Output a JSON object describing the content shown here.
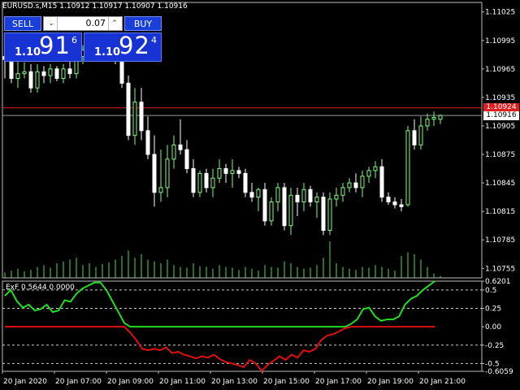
{
  "header": {
    "symbol_timeframe": "EURUSD.s,M15",
    "ohlc": "1.10912 1.10917 1.10907 1.10916"
  },
  "trade_panel": {
    "sell_label": "SELL",
    "buy_label": "BUY",
    "lot_value": "0.07",
    "bid": {
      "prefix": "1.10",
      "big": "91",
      "sup": "6"
    },
    "ask": {
      "prefix": "1.10",
      "big": "92",
      "sup": "4"
    }
  },
  "price_tags": {
    "ask": "1.10924",
    "bid": "1.10916"
  },
  "price_axis": [
    "1.11025",
    "1.10995",
    "1.10965",
    "1.10935",
    "1.10905",
    "1.10875",
    "1.10845",
    "1.10815",
    "1.10785",
    "1.10755"
  ],
  "indicator": {
    "title": "ExF 0.5644 0.0000",
    "axis": [
      "0.6201",
      "0.5",
      "0.25",
      "0.00",
      "-0.25",
      "-0.5",
      "-0.6059"
    ]
  },
  "time_axis": [
    "20 Jan 2020",
    "20 Jan 07:00",
    "20 Jan 09:00",
    "20 Jan 11:00",
    "20 Jan 13:00",
    "20 Jan 15:00",
    "20 Jan 17:00",
    "20 Jan 19:00",
    "20 Jan 21:00"
  ],
  "colors": {
    "bull": "#7cfc7c",
    "bear": "#ffffff",
    "grid": "#d9d9d9",
    "ask_line": "#e02020",
    "green_line": "#22dd22",
    "red_line": "#e01010"
  },
  "chart_data": [
    {
      "type": "candlestick",
      "title": "EURUSD.s,M15",
      "ylim": [
        1.10745,
        1.11035
      ],
      "candles": [
        {
          "o": 1.10978,
          "h": 1.10995,
          "l": 1.10955,
          "c": 1.10975
        },
        {
          "o": 1.10975,
          "h": 1.1099,
          "l": 1.1095,
          "c": 1.10955
        },
        {
          "o": 1.10955,
          "h": 1.10975,
          "l": 1.10945,
          "c": 1.1096
        },
        {
          "o": 1.1096,
          "h": 1.10972,
          "l": 1.10955,
          "c": 1.10962
        },
        {
          "o": 1.10962,
          "h": 1.1097,
          "l": 1.1094,
          "c": 1.10945
        },
        {
          "o": 1.10945,
          "h": 1.1097,
          "l": 1.1094,
          "c": 1.10962
        },
        {
          "o": 1.10962,
          "h": 1.10968,
          "l": 1.1095,
          "c": 1.10958
        },
        {
          "o": 1.10958,
          "h": 1.1097,
          "l": 1.1095,
          "c": 1.10965
        },
        {
          "o": 1.10965,
          "h": 1.10968,
          "l": 1.10952,
          "c": 1.10955
        },
        {
          "o": 1.10955,
          "h": 1.1097,
          "l": 1.1095,
          "c": 1.10965
        },
        {
          "o": 1.10965,
          "h": 1.1098,
          "l": 1.10955,
          "c": 1.1096
        },
        {
          "o": 1.1096,
          "h": 1.10985,
          "l": 1.10955,
          "c": 1.10978
        },
        {
          "o": 1.10978,
          "h": 1.1099,
          "l": 1.1097,
          "c": 1.10985
        },
        {
          "o": 1.10985,
          "h": 1.10995,
          "l": 1.10975,
          "c": 1.1099
        },
        {
          "o": 1.1099,
          "h": 1.11,
          "l": 1.10982,
          "c": 1.10988
        },
        {
          "o": 1.10988,
          "h": 1.10998,
          "l": 1.1098,
          "c": 1.10993
        },
        {
          "o": 1.10993,
          "h": 1.11002,
          "l": 1.10975,
          "c": 1.10985
        },
        {
          "o": 1.10985,
          "h": 1.10995,
          "l": 1.1097,
          "c": 1.1098
        },
        {
          "o": 1.1098,
          "h": 1.1099,
          "l": 1.10945,
          "c": 1.1095
        },
        {
          "o": 1.1095,
          "h": 1.10958,
          "l": 1.1089,
          "c": 1.10895
        },
        {
          "o": 1.10895,
          "h": 1.10945,
          "l": 1.10885,
          "c": 1.1093
        },
        {
          "o": 1.1093,
          "h": 1.10945,
          "l": 1.1089,
          "c": 1.109
        },
        {
          "o": 1.109,
          "h": 1.10915,
          "l": 1.1087,
          "c": 1.10875
        },
        {
          "o": 1.10875,
          "h": 1.10895,
          "l": 1.1082,
          "c": 1.10835
        },
        {
          "o": 1.10835,
          "h": 1.1088,
          "l": 1.10825,
          "c": 1.1084
        },
        {
          "o": 1.1084,
          "h": 1.10885,
          "l": 1.1083,
          "c": 1.1087
        },
        {
          "o": 1.1087,
          "h": 1.10895,
          "l": 1.1086,
          "c": 1.10885
        },
        {
          "o": 1.10885,
          "h": 1.10912,
          "l": 1.10875,
          "c": 1.1088
        },
        {
          "o": 1.1088,
          "h": 1.1089,
          "l": 1.10855,
          "c": 1.1086
        },
        {
          "o": 1.1086,
          "h": 1.1087,
          "l": 1.1083,
          "c": 1.10835
        },
        {
          "o": 1.10835,
          "h": 1.10858,
          "l": 1.1083,
          "c": 1.10855
        },
        {
          "o": 1.10855,
          "h": 1.1086,
          "l": 1.10835,
          "c": 1.1084
        },
        {
          "o": 1.1084,
          "h": 1.1086,
          "l": 1.1083,
          "c": 1.1085
        },
        {
          "o": 1.1085,
          "h": 1.1087,
          "l": 1.10845,
          "c": 1.1086
        },
        {
          "o": 1.1086,
          "h": 1.10865,
          "l": 1.10845,
          "c": 1.10855
        },
        {
          "o": 1.10855,
          "h": 1.1087,
          "l": 1.1084,
          "c": 1.10858
        },
        {
          "o": 1.10858,
          "h": 1.10862,
          "l": 1.1085,
          "c": 1.10855
        },
        {
          "o": 1.10855,
          "h": 1.1086,
          "l": 1.1083,
          "c": 1.10835
        },
        {
          "o": 1.10835,
          "h": 1.10845,
          "l": 1.10825,
          "c": 1.1083
        },
        {
          "o": 1.1083,
          "h": 1.1084,
          "l": 1.10815,
          "c": 1.10838
        },
        {
          "o": 1.10838,
          "h": 1.10845,
          "l": 1.108,
          "c": 1.10805
        },
        {
          "o": 1.10805,
          "h": 1.1083,
          "l": 1.108,
          "c": 1.10825
        },
        {
          "o": 1.10825,
          "h": 1.10845,
          "l": 1.10815,
          "c": 1.1084
        },
        {
          "o": 1.1084,
          "h": 1.10845,
          "l": 1.10795,
          "c": 1.108
        },
        {
          "o": 1.108,
          "h": 1.1084,
          "l": 1.1079,
          "c": 1.10832
        },
        {
          "o": 1.10832,
          "h": 1.1084,
          "l": 1.1081,
          "c": 1.10825
        },
        {
          "o": 1.10825,
          "h": 1.10845,
          "l": 1.10815,
          "c": 1.10838
        },
        {
          "o": 1.10838,
          "h": 1.10842,
          "l": 1.1082,
          "c": 1.10825
        },
        {
          "o": 1.10825,
          "h": 1.10835,
          "l": 1.10808,
          "c": 1.1083
        },
        {
          "o": 1.1083,
          "h": 1.10835,
          "l": 1.1079,
          "c": 1.10795
        },
        {
          "o": 1.10795,
          "h": 1.10835,
          "l": 1.1079,
          "c": 1.10828
        },
        {
          "o": 1.10828,
          "h": 1.1084,
          "l": 1.1082,
          "c": 1.10832
        },
        {
          "o": 1.10832,
          "h": 1.10845,
          "l": 1.10825,
          "c": 1.1084
        },
        {
          "o": 1.1084,
          "h": 1.1085,
          "l": 1.10835,
          "c": 1.10845
        },
        {
          "o": 1.10845,
          "h": 1.10855,
          "l": 1.10835,
          "c": 1.1084
        },
        {
          "o": 1.1084,
          "h": 1.10858,
          "l": 1.1083,
          "c": 1.10852
        },
        {
          "o": 1.10852,
          "h": 1.10862,
          "l": 1.10845,
          "c": 1.10858
        },
        {
          "o": 1.10858,
          "h": 1.10868,
          "l": 1.1085,
          "c": 1.10862
        },
        {
          "o": 1.10862,
          "h": 1.1087,
          "l": 1.10825,
          "c": 1.1083
        },
        {
          "o": 1.1083,
          "h": 1.10835,
          "l": 1.10822,
          "c": 1.10825
        },
        {
          "o": 1.10825,
          "h": 1.1083,
          "l": 1.10818,
          "c": 1.10822
        },
        {
          "o": 1.10822,
          "h": 1.10828,
          "l": 1.10815,
          "c": 1.1082
        },
        {
          "o": 1.10822,
          "h": 1.10905,
          "l": 1.1082,
          "c": 1.109
        },
        {
          "o": 1.109,
          "h": 1.10912,
          "l": 1.1088,
          "c": 1.10885
        },
        {
          "o": 1.10885,
          "h": 1.10915,
          "l": 1.1088,
          "c": 1.10905
        },
        {
          "o": 1.10905,
          "h": 1.10918,
          "l": 1.109,
          "c": 1.10912
        },
        {
          "o": 1.10912,
          "h": 1.1092,
          "l": 1.10905,
          "c": 1.10914
        },
        {
          "o": 1.10912,
          "h": 1.10917,
          "l": 1.10907,
          "c": 1.10916
        }
      ],
      "volumes": [
        0.15,
        0.2,
        0.25,
        0.18,
        0.22,
        0.3,
        0.35,
        0.28,
        0.4,
        0.45,
        0.5,
        0.55,
        0.35,
        0.4,
        0.3,
        0.38,
        0.42,
        0.5,
        0.6,
        0.75,
        0.55,
        0.65,
        0.5,
        0.45,
        0.4,
        0.5,
        0.35,
        0.3,
        0.28,
        0.4,
        0.32,
        0.3,
        0.25,
        0.35,
        0.3,
        0.28,
        0.22,
        0.3,
        0.25,
        0.2,
        0.35,
        0.3,
        0.28,
        0.45,
        0.4,
        0.3,
        0.25,
        0.28,
        0.35,
        0.55,
        1.0,
        0.4,
        0.3,
        0.25,
        0.22,
        0.3,
        0.28,
        0.35,
        0.3,
        0.25,
        0.2,
        0.6,
        0.7,
        0.65,
        0.5,
        0.3,
        0.12,
        0.05
      ]
    },
    {
      "type": "line",
      "title": "ExF 0.5644 0.0000",
      "ylim": [
        -0.6059,
        0.6201
      ],
      "series": [
        {
          "color": "#22dd22",
          "values": [
            0.42,
            0.5,
            0.35,
            0.26,
            0.3,
            0.22,
            0.24,
            0.3,
            0.2,
            0.22,
            0.36,
            0.34,
            0.45,
            0.52,
            0.56,
            0.6,
            0.6,
            0.5,
            0.35,
            0.2,
            0.05,
            0.0,
            0.0,
            0.0,
            0.0,
            0.0,
            0.0,
            0.0,
            0.0,
            0.0,
            0.0,
            0.0,
            0.0,
            0.0,
            0.0,
            0.0,
            0.0,
            0.0,
            0.0,
            0.0,
            0.0,
            0.0,
            0.0,
            0.0,
            0.0,
            0.0,
            0.0,
            0.0,
            0.0,
            0.0,
            0.0,
            0.0,
            0.0,
            0.0,
            0.0,
            0.0,
            0.0,
            0.0,
            0.04,
            0.1,
            0.24,
            0.26,
            0.14,
            0.08,
            0.1,
            0.1,
            0.14,
            0.3,
            0.38,
            0.42,
            0.5,
            0.56,
            0.62
          ]
        },
        {
          "color": "#e01010",
          "values": [
            0.0,
            0.0,
            0.0,
            0.0,
            0.0,
            0.0,
            0.0,
            0.0,
            0.0,
            0.0,
            0.0,
            0.0,
            0.0,
            0.0,
            0.0,
            0.0,
            0.0,
            0.0,
            0.0,
            0.0,
            0.0,
            -0.08,
            -0.18,
            -0.3,
            -0.32,
            -0.3,
            -0.32,
            -0.28,
            -0.36,
            -0.34,
            -0.38,
            -0.4,
            -0.43,
            -0.4,
            -0.42,
            -0.38,
            -0.44,
            -0.48,
            -0.5,
            -0.52,
            -0.55,
            -0.45,
            -0.5,
            -0.6,
            -0.52,
            -0.46,
            -0.4,
            -0.45,
            -0.38,
            -0.42,
            -0.32,
            -0.34,
            -0.3,
            -0.18,
            -0.12,
            -0.1,
            -0.06,
            -0.02,
            0.0,
            0.0,
            0.0,
            0.0,
            0.0,
            0.0,
            0.0,
            0.0,
            0.0,
            0.0,
            0.0,
            0.0,
            0.0,
            0.0,
            0.0
          ]
        }
      ]
    }
  ]
}
